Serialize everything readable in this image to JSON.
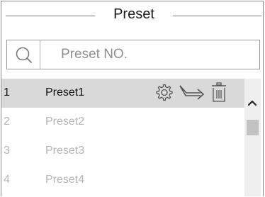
{
  "header": {
    "title": "Preset"
  },
  "search": {
    "placeholder": "Preset NO.",
    "value": ""
  },
  "icons": {
    "search": "search-icon",
    "settings": "gear-icon",
    "call": "arrow-goto-icon",
    "delete": "trash-icon",
    "scroll_up": "chevron-up-icon"
  },
  "colors": {
    "selected_row_bg": "#d9d9d9",
    "dim_text": "#b5b5b5",
    "border": "#8a8a8a"
  },
  "presets": [
    {
      "number": "1",
      "name": "Preset1",
      "selected": true
    },
    {
      "number": "2",
      "name": "Preset2",
      "selected": false
    },
    {
      "number": "3",
      "name": "Preset3",
      "selected": false
    },
    {
      "number": "4",
      "name": "Preset4",
      "selected": false
    }
  ]
}
